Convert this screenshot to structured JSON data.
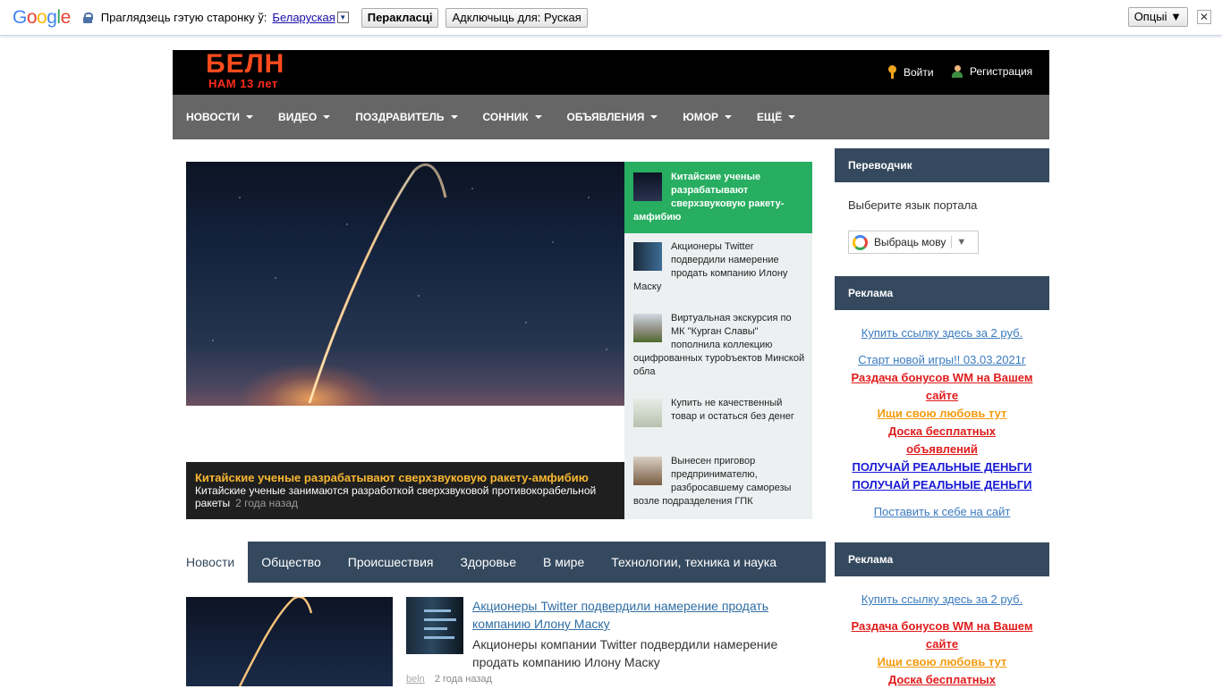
{
  "translate_bar": {
    "logo": [
      "G",
      "o",
      "o",
      "g",
      "l",
      "e"
    ],
    "prompt": "Праглядзець гэтую старонку ў:",
    "language": "Беларуская",
    "translate_button": "Перакласці",
    "turn_off_button": "Адключыць для: Руская",
    "options_button": "Опцыі ▼",
    "close": "✕"
  },
  "header": {
    "logo_main": "БЕЛН",
    "logo_sub": "НАМ 13 лет",
    "login": "Войти",
    "register": "Регистрация"
  },
  "nav": {
    "items": [
      "НОВОСТИ",
      "ВИДЕО",
      "ПОЗДРАВИТЕЛЬ",
      "СОННИК",
      "ОБЪЯВЛЕНИЯ",
      "ЮМОР",
      "ЕЩЁ"
    ]
  },
  "hero": {
    "title": "Китайские ученые разрабатывают сверхзвуковую ракету-амфибию",
    "description": "Китайские ученые занимаются разработкой сверхзвуковой противокорабельной ракеты",
    "time": "2 года назад"
  },
  "side_news": [
    "Китайские ученые разрабатывают сверхзвуковую ракету-амфибию",
    "Акционеры Twitter подвердили намерение продать компанию Илону Маску",
    "Виртуальная экскурсия по МК \"Курган Славы\" пополнила коллекцию оцифрованных турobъектов Минской обла",
    "Купить не качественный товар и остаться без денег",
    "Вынесен приговор предпринимателю, разбросавшему саморезы возле подразделения ГПК"
  ],
  "tabs": [
    "Новости",
    "Общество",
    "Происшествия",
    "Здоровье",
    "В мире",
    "Технологии, техника и наука"
  ],
  "bottom_news": {
    "title": "Акционеры Twitter подвердили намерение продать компанию Илону Маску",
    "description": "Акционеры компании Twitter подвердили намерение продать компанию Илону Маску",
    "author": "beln",
    "time": "2 года назад"
  },
  "sidebar": {
    "translator_title": "Переводчик",
    "translator_text": "Выберите язык портала",
    "translator_select": "Выбраць мову",
    "ads_title_1": "Реклама",
    "ads_1": [
      "Купить ссылку здесь за 2 руб.",
      "Старт новой игры!! 03.03.2021г",
      "Раздача бонусов WM на Вашем сайте",
      "Ищи свою любовь тут",
      "Доска бесплатных объявлений",
      "ПОЛУЧАЙ РЕАЛЬНЫЕ ДЕНЬГИ",
      "ПОЛУЧАЙ РЕАЛЬНЫЕ ДЕНЬГИ",
      "Поставить к себе на сайт"
    ],
    "ads_title_2": "Реклама",
    "ads_2": [
      "Купить ссылку здесь за 2 руб.",
      "Раздача бонусов WM на Вашем сайте",
      "Ищи свою любовь тут",
      "Доска бесплатных"
    ]
  },
  "colors": {
    "logo": "#ff4a1c",
    "nav_bg": "#666666",
    "tabs_bg": "#34495e",
    "active_side": "#27ae60",
    "hero_title": "#f7b731"
  }
}
